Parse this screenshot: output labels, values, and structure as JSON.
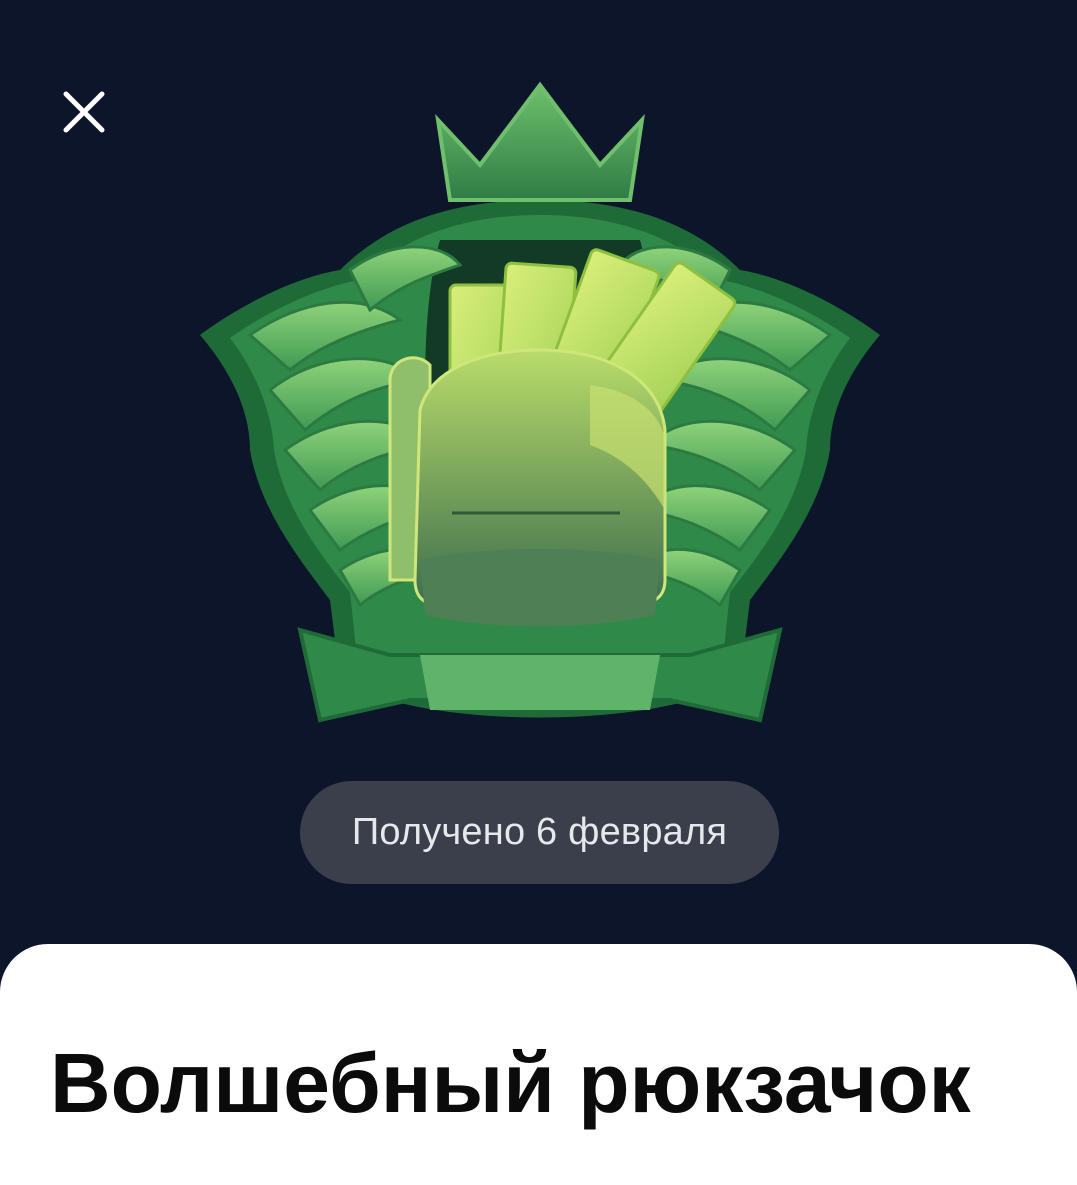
{
  "header": {
    "close_icon": "close-icon"
  },
  "achievement": {
    "image_icon": "magic-backpack-badge-icon",
    "received_label": "Получено 6 февраля",
    "title": "Волшебный рюкзачок"
  },
  "colors": {
    "background": "#0d152a",
    "pill_background": "#3a3f4b",
    "pill_text": "#e6e8ec",
    "sheet_background": "#ffffff",
    "title_text": "#0b0b0b",
    "badge_green_dark": "#1f6b37",
    "badge_green_light": "#8fd37a",
    "bill_green": "#c7e46a"
  }
}
